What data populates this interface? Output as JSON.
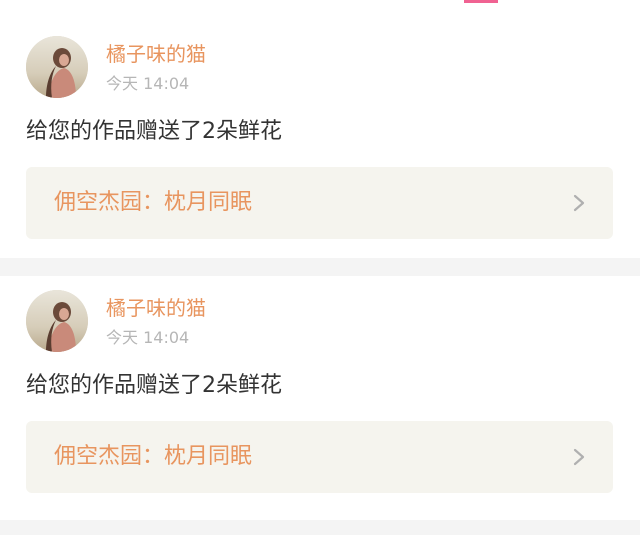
{
  "notifications": [
    {
      "username": "橘子味的猫",
      "time": "今天 14:04",
      "message": "给您的作品赠送了2朵鲜花",
      "work_label": "佣空杰园：枕月同眠",
      "avatar_icon": "avatar-photo",
      "link_icon": "chevron-right-icon"
    },
    {
      "username": "橘子味的猫",
      "time": "今天 14:04",
      "message": "给您的作品赠送了2朵鲜花",
      "work_label": "佣空杰园：枕月同眠",
      "avatar_icon": "avatar-photo",
      "link_icon": "chevron-right-icon"
    }
  ],
  "colors": {
    "accent": "#e8955f",
    "muted_text": "#b6b6b6",
    "body_text": "#333333",
    "link_background": "#f5f4ee",
    "divider": "#f4f4f4",
    "tab_indicator": "#f06292"
  }
}
